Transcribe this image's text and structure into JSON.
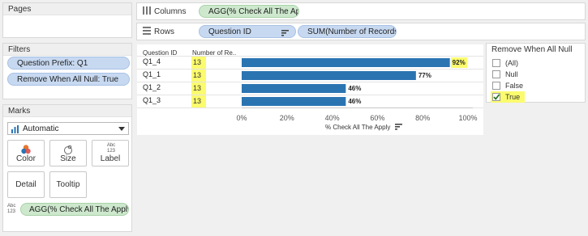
{
  "cards": {
    "pages_title": "Pages",
    "filters_title": "Filters",
    "marks_title": "Marks"
  },
  "filters": [
    "Question Prefix: Q1",
    "Remove When All Null: True"
  ],
  "shelves": {
    "columns_label": "Columns",
    "columns_pill": "AGG(% Check All The Ap..",
    "rows_label": "Rows",
    "rows_pill_1": "Question ID",
    "rows_pill_2": "SUM(Number of Records)"
  },
  "marks": {
    "type": "Automatic",
    "color": "Color",
    "size": "Size",
    "label": "Label",
    "label_icon_text": "Abc 123",
    "detail": "Detail",
    "tooltip": "Tooltip",
    "field_icon_text": "Abc 123",
    "field_pill": "AGG(% Check All The Apply)"
  },
  "viz": {
    "col_header_1": "Question ID",
    "col_header_2": "Number of Re..",
    "x_axis_title": "% Check All The Apply"
  },
  "chart_data": {
    "type": "bar",
    "categories": [
      "Q1_4",
      "Q1_1",
      "Q1_2",
      "Q1_3"
    ],
    "counts": [
      "13",
      "13",
      "13",
      "13"
    ],
    "values": [
      0.92,
      0.77,
      0.46,
      0.46
    ],
    "value_labels": [
      "92%",
      "77%",
      "46%",
      "46%"
    ],
    "xlabel": "% Check All The Apply",
    "xlim": [
      0,
      1.0
    ],
    "ticks": [
      "0%",
      "20%",
      "40%",
      "60%",
      "80%",
      "100%"
    ],
    "tick_values": [
      0,
      0.2,
      0.4,
      0.6,
      0.8,
      1.0
    ],
    "highlighted_label": "92%",
    "colors": {
      "bar": "#2b74b2",
      "highlight": "#fbfb6e"
    }
  },
  "remove_filter": {
    "title": "Remove When All Null",
    "options": [
      {
        "label": "(All)",
        "checked": false
      },
      {
        "label": "Null",
        "checked": false
      },
      {
        "label": "False",
        "checked": false
      },
      {
        "label": "True",
        "checked": true
      }
    ]
  }
}
